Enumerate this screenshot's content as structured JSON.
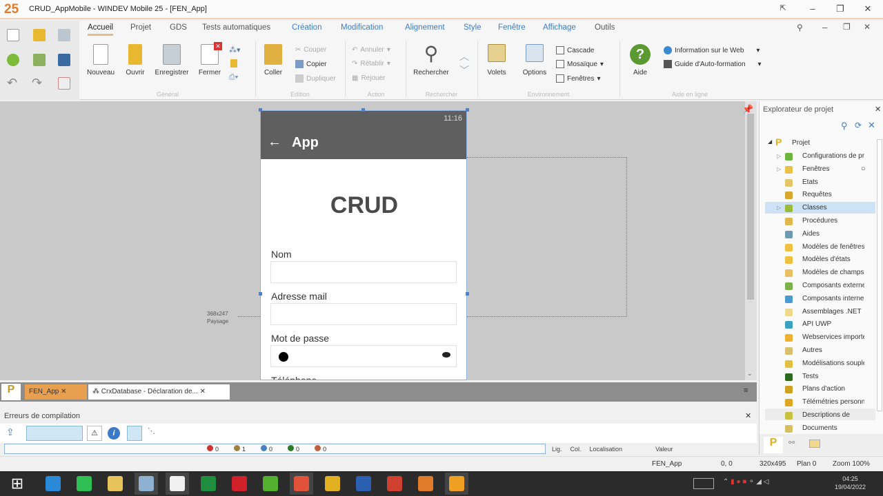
{
  "window": {
    "title": "CRUD_AppMobile - WINDEV Mobile 25 - [FEN_App]",
    "logo": "25"
  },
  "ribbon": {
    "tabs": [
      {
        "label": "Accueil"
      },
      {
        "label": "Projet"
      },
      {
        "label": "GDS"
      },
      {
        "label": "Tests automatiques"
      },
      {
        "label": "Création"
      },
      {
        "label": "Modification"
      },
      {
        "label": "Alignement"
      },
      {
        "label": "Style"
      },
      {
        "label": "Fenêtre"
      },
      {
        "label": "Affichage"
      },
      {
        "label": "Outils"
      }
    ],
    "general": {
      "nouveau": "Nouveau",
      "ouvrir": "Ouvrir",
      "enregistrer": "Enregistrer",
      "fermer": "Fermer",
      "group": "Général"
    },
    "edition": {
      "coller": "Coller",
      "couper": "Couper",
      "copier": "Copier",
      "dupliquer": "Dupliquer",
      "group": "Edition"
    },
    "action": {
      "annuler": "Annuler",
      "retablir": "Rétablir",
      "rejouer": "Rejouer",
      "group": "Action"
    },
    "rechercher": {
      "rechercher": "Rechercher",
      "group": "Rechercher"
    },
    "environnement": {
      "volets": "Volets",
      "options": "Options",
      "cascade": "Cascade",
      "mosaique": "Mosaïque",
      "fenetres": "Fenêtres",
      "group": "Environnement"
    },
    "aide": {
      "aide": "Aide",
      "info_web": "Information sur le Web",
      "guide": "Guide d'Auto-formation",
      "group": "Aide en ligne"
    }
  },
  "phone": {
    "time": "11:16",
    "header": "App",
    "title": "CRUD",
    "fields": [
      {
        "label": "Nom"
      },
      {
        "label": "Adresse mail"
      },
      {
        "label": "Mot de passe"
      },
      {
        "label": "Téléphone"
      }
    ]
  },
  "editor": {
    "size_label": "368x247",
    "orientation_label": "Paysage"
  },
  "explorer": {
    "title": "Explorateur de projet",
    "root": "Projet",
    "items": [
      {
        "label": "Configurations de projet",
        "color": "#6bb53f"
      },
      {
        "label": "Fenêtres",
        "color": "#e8c04a"
      },
      {
        "label": "Etats",
        "color": "#e5c56a"
      },
      {
        "label": "Requêtes",
        "color": "#d9a62e"
      },
      {
        "label": "Classes",
        "color": "#9bbb3a"
      },
      {
        "label": "Procédures",
        "color": "#e0b850"
      },
      {
        "label": "Aides",
        "color": "#6c9ab0"
      },
      {
        "label": "Modèles de fenêtres",
        "color": "#f0c040"
      },
      {
        "label": "Modèles d'états",
        "color": "#f0c040"
      },
      {
        "label": "Modèles de champs",
        "color": "#e8c060"
      },
      {
        "label": "Composants externes",
        "color": "#7bb04a"
      },
      {
        "label": "Composants internes",
        "color": "#4a9ad0"
      },
      {
        "label": "Assemblages .NET",
        "color": "#eed890"
      },
      {
        "label": "API UWP",
        "color": "#3aa0c0"
      },
      {
        "label": "Webservices importés",
        "color": "#f0b030"
      },
      {
        "label": "Autres",
        "color": "#d8c070"
      },
      {
        "label": "Modélisations souples",
        "color": "#e0c040"
      },
      {
        "label": "Tests",
        "color": "#2d6a1f"
      },
      {
        "label": "Plans d'action",
        "color": "#d0a020"
      },
      {
        "label": "Télémétries personnalisées",
        "color": "#e0a820"
      },
      {
        "label": "Descriptions de",
        "color": "#c8c040"
      },
      {
        "label": "Documents",
        "color": "#d8c060"
      }
    ]
  },
  "doc_tabs": [
    {
      "label": "FEN_App"
    },
    {
      "label": "CrxDatabase - Déclaration de..."
    }
  ],
  "errors": {
    "title": "Erreurs de compilation",
    "counts": [
      {
        "icon": "error",
        "value": "0",
        "color": "#d03030"
      },
      {
        "icon": "warning-box",
        "value": "1",
        "color": "#a08040"
      },
      {
        "icon": "info",
        "value": "0",
        "color": "#4a80c0"
      },
      {
        "icon": "green",
        "value": "0",
        "color": "#2a7a2a"
      },
      {
        "icon": "alert",
        "value": "0",
        "color": "#c06040"
      }
    ],
    "columns": [
      "Lig.",
      "Col.",
      "Localisation",
      "Valeur"
    ]
  },
  "status": {
    "window": "FEN_App",
    "coords": "0, 0",
    "size": "320x495",
    "plan": "Plan 0",
    "zoom": "Zoom 100%"
  },
  "taskbar": {
    "time": "04:25",
    "date": "19/04/2022",
    "apps": [
      {
        "name": "ie",
        "color": "#2a8ad8"
      },
      {
        "name": "whatsapp",
        "color": "#2fbf55"
      },
      {
        "name": "explorer",
        "color": "#e6c45a"
      },
      {
        "name": "app",
        "color": "#8fb0d0"
      },
      {
        "name": "notepad",
        "color": "#f0f0f0"
      },
      {
        "name": "excel-like",
        "color": "#1e8e3e"
      },
      {
        "name": "opera",
        "color": "#d0202a"
      },
      {
        "name": "camtasia-green",
        "color": "#55b030"
      },
      {
        "name": "camtasia",
        "color": "#e0533a"
      },
      {
        "name": "chrome",
        "color": "#e0b020"
      },
      {
        "name": "word",
        "color": "#2b5fb0"
      },
      {
        "name": "chrome-2",
        "color": "#d04030"
      },
      {
        "name": "windev",
        "color": "#e07b2a"
      },
      {
        "name": "sublime",
        "color": "#f0a020"
      }
    ]
  }
}
